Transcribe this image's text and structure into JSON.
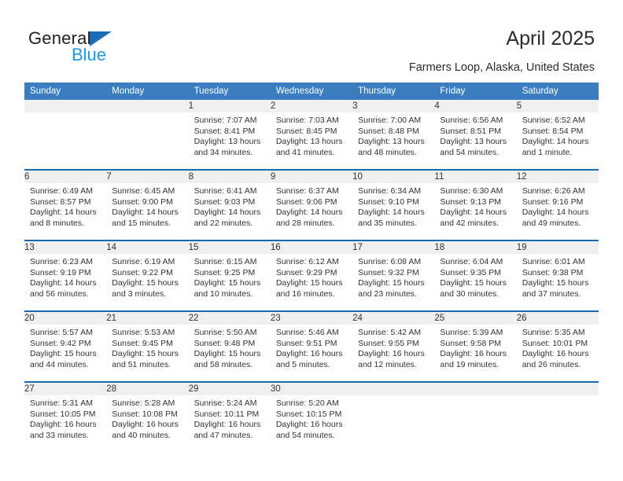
{
  "brand": {
    "name_part1": "General",
    "name_part2": "Blue",
    "triangle_color": "#1b6cb5",
    "blue_color": "#2196e3"
  },
  "header": {
    "title": "April 2025",
    "subtitle": "Farmers Loop, Alaska, United States"
  },
  "theme": {
    "header_bg": "#3a7ebf",
    "rule_color": "#1a6aad",
    "daynum_bg": "#efefef",
    "text_color": "#333333"
  },
  "weekday_headers": [
    "Sunday",
    "Monday",
    "Tuesday",
    "Wednesday",
    "Thursday",
    "Friday",
    "Saturday"
  ],
  "labels": {
    "sunrise": "Sunrise:",
    "sunset": "Sunset:",
    "daylight": "Daylight:"
  },
  "weeks": [
    [
      {
        "day": "",
        "sunrise": "",
        "sunset": "",
        "daylight_line1": "",
        "daylight_line2": ""
      },
      {
        "day": "",
        "sunrise": "",
        "sunset": "",
        "daylight_line1": "",
        "daylight_line2": ""
      },
      {
        "day": "1",
        "sunrise": "Sunrise: 7:07 AM",
        "sunset": "Sunset: 8:41 PM",
        "daylight_line1": "Daylight: 13 hours",
        "daylight_line2": "and 34 minutes."
      },
      {
        "day": "2",
        "sunrise": "Sunrise: 7:03 AM",
        "sunset": "Sunset: 8:45 PM",
        "daylight_line1": "Daylight: 13 hours",
        "daylight_line2": "and 41 minutes."
      },
      {
        "day": "3",
        "sunrise": "Sunrise: 7:00 AM",
        "sunset": "Sunset: 8:48 PM",
        "daylight_line1": "Daylight: 13 hours",
        "daylight_line2": "and 48 minutes."
      },
      {
        "day": "4",
        "sunrise": "Sunrise: 6:56 AM",
        "sunset": "Sunset: 8:51 PM",
        "daylight_line1": "Daylight: 13 hours",
        "daylight_line2": "and 54 minutes."
      },
      {
        "day": "5",
        "sunrise": "Sunrise: 6:52 AM",
        "sunset": "Sunset: 8:54 PM",
        "daylight_line1": "Daylight: 14 hours",
        "daylight_line2": "and 1 minute."
      }
    ],
    [
      {
        "day": "6",
        "sunrise": "Sunrise: 6:49 AM",
        "sunset": "Sunset: 8:57 PM",
        "daylight_line1": "Daylight: 14 hours",
        "daylight_line2": "and 8 minutes."
      },
      {
        "day": "7",
        "sunrise": "Sunrise: 6:45 AM",
        "sunset": "Sunset: 9:00 PM",
        "daylight_line1": "Daylight: 14 hours",
        "daylight_line2": "and 15 minutes."
      },
      {
        "day": "8",
        "sunrise": "Sunrise: 6:41 AM",
        "sunset": "Sunset: 9:03 PM",
        "daylight_line1": "Daylight: 14 hours",
        "daylight_line2": "and 22 minutes."
      },
      {
        "day": "9",
        "sunrise": "Sunrise: 6:37 AM",
        "sunset": "Sunset: 9:06 PM",
        "daylight_line1": "Daylight: 14 hours",
        "daylight_line2": "and 28 minutes."
      },
      {
        "day": "10",
        "sunrise": "Sunrise: 6:34 AM",
        "sunset": "Sunset: 9:10 PM",
        "daylight_line1": "Daylight: 14 hours",
        "daylight_line2": "and 35 minutes."
      },
      {
        "day": "11",
        "sunrise": "Sunrise: 6:30 AM",
        "sunset": "Sunset: 9:13 PM",
        "daylight_line1": "Daylight: 14 hours",
        "daylight_line2": "and 42 minutes."
      },
      {
        "day": "12",
        "sunrise": "Sunrise: 6:26 AM",
        "sunset": "Sunset: 9:16 PM",
        "daylight_line1": "Daylight: 14 hours",
        "daylight_line2": "and 49 minutes."
      }
    ],
    [
      {
        "day": "13",
        "sunrise": "Sunrise: 6:23 AM",
        "sunset": "Sunset: 9:19 PM",
        "daylight_line1": "Daylight: 14 hours",
        "daylight_line2": "and 56 minutes."
      },
      {
        "day": "14",
        "sunrise": "Sunrise: 6:19 AM",
        "sunset": "Sunset: 9:22 PM",
        "daylight_line1": "Daylight: 15 hours",
        "daylight_line2": "and 3 minutes."
      },
      {
        "day": "15",
        "sunrise": "Sunrise: 6:15 AM",
        "sunset": "Sunset: 9:25 PM",
        "daylight_line1": "Daylight: 15 hours",
        "daylight_line2": "and 10 minutes."
      },
      {
        "day": "16",
        "sunrise": "Sunrise: 6:12 AM",
        "sunset": "Sunset: 9:29 PM",
        "daylight_line1": "Daylight: 15 hours",
        "daylight_line2": "and 16 minutes."
      },
      {
        "day": "17",
        "sunrise": "Sunrise: 6:08 AM",
        "sunset": "Sunset: 9:32 PM",
        "daylight_line1": "Daylight: 15 hours",
        "daylight_line2": "and 23 minutes."
      },
      {
        "day": "18",
        "sunrise": "Sunrise: 6:04 AM",
        "sunset": "Sunset: 9:35 PM",
        "daylight_line1": "Daylight: 15 hours",
        "daylight_line2": "and 30 minutes."
      },
      {
        "day": "19",
        "sunrise": "Sunrise: 6:01 AM",
        "sunset": "Sunset: 9:38 PM",
        "daylight_line1": "Daylight: 15 hours",
        "daylight_line2": "and 37 minutes."
      }
    ],
    [
      {
        "day": "20",
        "sunrise": "Sunrise: 5:57 AM",
        "sunset": "Sunset: 9:42 PM",
        "daylight_line1": "Daylight: 15 hours",
        "daylight_line2": "and 44 minutes."
      },
      {
        "day": "21",
        "sunrise": "Sunrise: 5:53 AM",
        "sunset": "Sunset: 9:45 PM",
        "daylight_line1": "Daylight: 15 hours",
        "daylight_line2": "and 51 minutes."
      },
      {
        "day": "22",
        "sunrise": "Sunrise: 5:50 AM",
        "sunset": "Sunset: 9:48 PM",
        "daylight_line1": "Daylight: 15 hours",
        "daylight_line2": "and 58 minutes."
      },
      {
        "day": "23",
        "sunrise": "Sunrise: 5:46 AM",
        "sunset": "Sunset: 9:51 PM",
        "daylight_line1": "Daylight: 16 hours",
        "daylight_line2": "and 5 minutes."
      },
      {
        "day": "24",
        "sunrise": "Sunrise: 5:42 AM",
        "sunset": "Sunset: 9:55 PM",
        "daylight_line1": "Daylight: 16 hours",
        "daylight_line2": "and 12 minutes."
      },
      {
        "day": "25",
        "sunrise": "Sunrise: 5:39 AM",
        "sunset": "Sunset: 9:58 PM",
        "daylight_line1": "Daylight: 16 hours",
        "daylight_line2": "and 19 minutes."
      },
      {
        "day": "26",
        "sunrise": "Sunrise: 5:35 AM",
        "sunset": "Sunset: 10:01 PM",
        "daylight_line1": "Daylight: 16 hours",
        "daylight_line2": "and 26 minutes."
      }
    ],
    [
      {
        "day": "27",
        "sunrise": "Sunrise: 5:31 AM",
        "sunset": "Sunset: 10:05 PM",
        "daylight_line1": "Daylight: 16 hours",
        "daylight_line2": "and 33 minutes."
      },
      {
        "day": "28",
        "sunrise": "Sunrise: 5:28 AM",
        "sunset": "Sunset: 10:08 PM",
        "daylight_line1": "Daylight: 16 hours",
        "daylight_line2": "and 40 minutes."
      },
      {
        "day": "29",
        "sunrise": "Sunrise: 5:24 AM",
        "sunset": "Sunset: 10:11 PM",
        "daylight_line1": "Daylight: 16 hours",
        "daylight_line2": "and 47 minutes."
      },
      {
        "day": "30",
        "sunrise": "Sunrise: 5:20 AM",
        "sunset": "Sunset: 10:15 PM",
        "daylight_line1": "Daylight: 16 hours",
        "daylight_line2": "and 54 minutes."
      },
      {
        "day": "",
        "sunrise": "",
        "sunset": "",
        "daylight_line1": "",
        "daylight_line2": ""
      },
      {
        "day": "",
        "sunrise": "",
        "sunset": "",
        "daylight_line1": "",
        "daylight_line2": ""
      },
      {
        "day": "",
        "sunrise": "",
        "sunset": "",
        "daylight_line1": "",
        "daylight_line2": ""
      }
    ]
  ]
}
